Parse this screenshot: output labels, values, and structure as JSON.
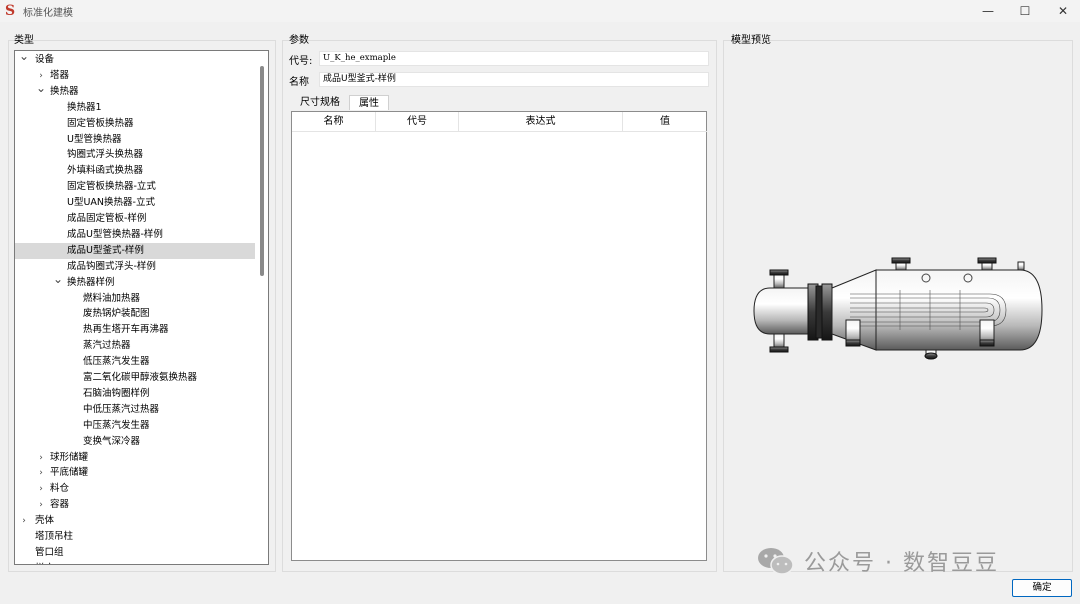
{
  "window": {
    "title": "标准化建模",
    "logo_glyph": "S",
    "controls": {
      "minimize": "—",
      "maximize": "☐",
      "close": "✕"
    }
  },
  "type_panel": {
    "title": "类型",
    "tree": [
      {
        "label": "设备",
        "level": 0,
        "arrow": "expanded"
      },
      {
        "label": "塔器",
        "level": 1,
        "arrow": "collapsed"
      },
      {
        "label": "换热器",
        "level": 1,
        "arrow": "expanded"
      },
      {
        "label": "换热器1",
        "level": 2,
        "arrow": "none"
      },
      {
        "label": "固定管板换热器",
        "level": 2,
        "arrow": "none"
      },
      {
        "label": "U型管换热器",
        "level": 2,
        "arrow": "none"
      },
      {
        "label": "钩圈式浮头换热器",
        "level": 2,
        "arrow": "none"
      },
      {
        "label": "外填料函式换热器",
        "level": 2,
        "arrow": "none"
      },
      {
        "label": "固定管板换热器-立式",
        "level": 2,
        "arrow": "none"
      },
      {
        "label": "U型UAN换热器-立式",
        "level": 2,
        "arrow": "none"
      },
      {
        "label": "成品固定管板-样例",
        "level": 2,
        "arrow": "none"
      },
      {
        "label": "成品U型管换热器-样例",
        "level": 2,
        "arrow": "none"
      },
      {
        "label": "成品U型釜式-样例",
        "level": 2,
        "arrow": "none",
        "selected": true
      },
      {
        "label": "成品钩圈式浮头-样例",
        "level": 2,
        "arrow": "none"
      },
      {
        "label": "换热器样例",
        "level": 2,
        "arrow": "expanded"
      },
      {
        "label": "燃料油加热器",
        "level": 3,
        "arrow": "none"
      },
      {
        "label": "废热锅炉装配图",
        "level": 3,
        "arrow": "none"
      },
      {
        "label": "热再生塔开车再沸器",
        "level": 3,
        "arrow": "none"
      },
      {
        "label": "蒸汽过热器",
        "level": 3,
        "arrow": "none"
      },
      {
        "label": "低压蒸汽发生器",
        "level": 3,
        "arrow": "none"
      },
      {
        "label": "富二氧化碳甲醇液氨换热器",
        "level": 3,
        "arrow": "none"
      },
      {
        "label": "石脑油钩圈样例",
        "level": 3,
        "arrow": "none"
      },
      {
        "label": "中低压蒸汽过热器",
        "level": 3,
        "arrow": "none"
      },
      {
        "label": "中压蒸汽发生器",
        "level": 3,
        "arrow": "none"
      },
      {
        "label": "变换气深冷器",
        "level": 3,
        "arrow": "none"
      },
      {
        "label": "球形储罐",
        "level": 1,
        "arrow": "collapsed"
      },
      {
        "label": "平底储罐",
        "level": 1,
        "arrow": "collapsed"
      },
      {
        "label": "料仓",
        "level": 1,
        "arrow": "collapsed"
      },
      {
        "label": "容器",
        "level": 1,
        "arrow": "collapsed"
      },
      {
        "label": "壳体",
        "level": 0,
        "arrow": "collapsed"
      },
      {
        "label": "塔顶吊柱",
        "level": 0,
        "arrow": "none"
      },
      {
        "label": "管口组",
        "level": 0,
        "arrow": "none"
      },
      {
        "label": "梯床",
        "level": 0,
        "arrow": "collapsed"
      }
    ]
  },
  "params_panel": {
    "title": "参数",
    "code_label": "代号:",
    "code_value": "U_K_he_exmaple",
    "name_label": "名称",
    "name_value": "成品U型釜式-样例",
    "tabs": [
      {
        "label": "尺寸规格",
        "active": false
      },
      {
        "label": "属性",
        "active": true
      }
    ],
    "table_headers": [
      "名称",
      "代号",
      "表达式",
      "值"
    ]
  },
  "preview_panel": {
    "title": "模型预览"
  },
  "watermark": {
    "text": "公众号 · 数智豆豆"
  },
  "footer": {
    "ok_label": "确定"
  }
}
